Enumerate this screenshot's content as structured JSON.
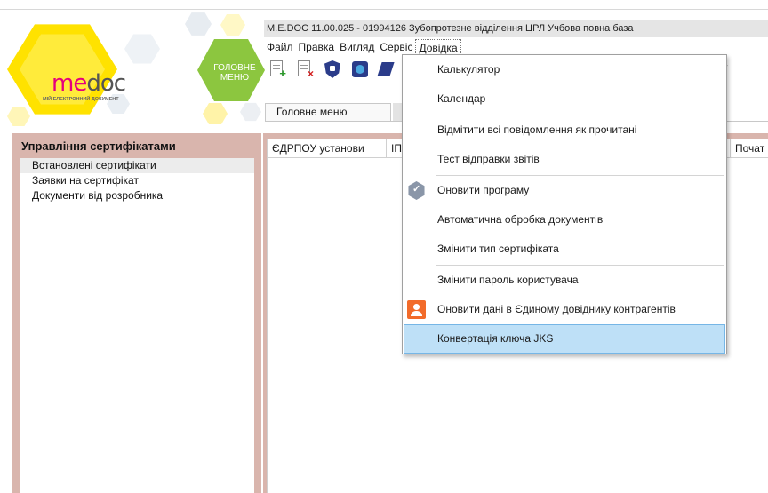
{
  "window": {
    "title": "M.E.DOC 11.00.025  - 01994126 Зубопротезне відділення ЦРЛ Учбова повна база"
  },
  "logo": {
    "brand_me": "me",
    "brand_doc": "doc",
    "tagline": "МІЙ ЕЛЕКТРОННИЙ ДОКУМЕНТ",
    "main_menu_label": "ГОЛОВНЕ МЕНЮ"
  },
  "menubar": [
    "Файл",
    "Правка",
    "Вигляд",
    "Сервіс",
    "Довідка"
  ],
  "toolbar": {
    "icons": [
      "add-document-icon",
      "delete-document-icon",
      "shield-icon",
      "settings-icon",
      "certificate-icon"
    ]
  },
  "tabs": {
    "main": "Головне меню"
  },
  "left_panel": {
    "heading": "Управління сертифікатами",
    "items": [
      "Встановлені сертифікати",
      "Заявки на сертифікат",
      "Документи від розробника"
    ],
    "selected_index": 0
  },
  "grid": {
    "columns": [
      "ЄДРПОУ установи",
      "ІП",
      "Почат"
    ]
  },
  "service_menu": {
    "items": [
      {
        "label": "Калькулятор",
        "icon": ""
      },
      {
        "label": "Календар",
        "icon": ""
      },
      {
        "label": "Відмітити всі повідомлення як прочитані",
        "icon": ""
      },
      {
        "label": "Тест відправки звітів",
        "icon": ""
      },
      {
        "label": "Оновити програму",
        "icon": "update-shield-icon"
      },
      {
        "label": "Автоматична обробка документів",
        "icon": ""
      },
      {
        "label": "Змінити тип сертифіката",
        "icon": ""
      },
      {
        "label": "Змінити пароль користувача",
        "icon": ""
      },
      {
        "label": "Оновити дані в Єдиному довіднику контрагентів",
        "icon": "contractors-directory-icon"
      },
      {
        "label": "Конвертація ключа JKS",
        "icon": ""
      }
    ],
    "highlighted_index": 9
  },
  "colors": {
    "panel_background": "#d9b5ad",
    "logo_yellow": "#ffe200",
    "logo_green": "#8cc63f",
    "menu_highlight": "#bee0f7"
  }
}
